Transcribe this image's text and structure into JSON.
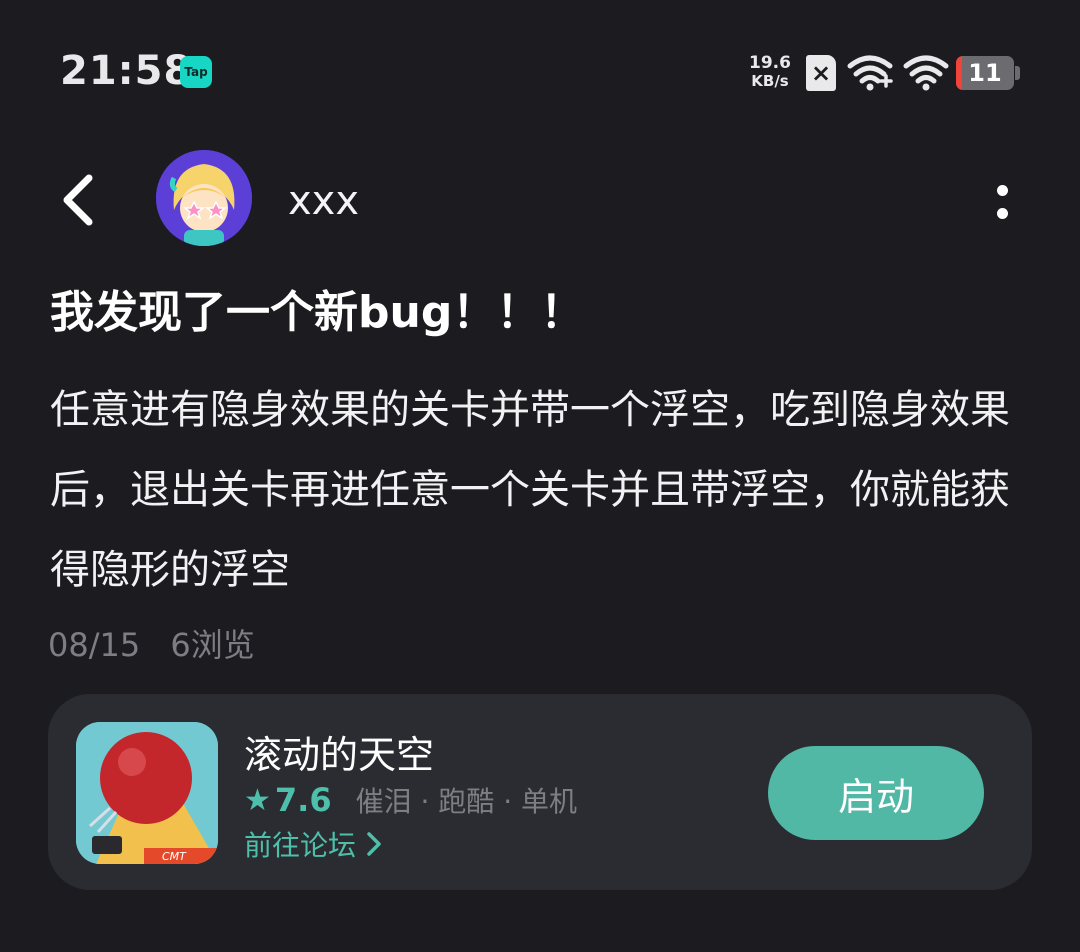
{
  "status_bar": {
    "time": "21:58",
    "tap_badge": "Tap",
    "net_speed_value": "19.6",
    "net_speed_unit": "KB/s",
    "battery_level": "11",
    "icons": [
      "tap-badge-icon",
      "sim-x-icon",
      "wifi-plus-icon",
      "wifi-icon",
      "battery-icon"
    ]
  },
  "header": {
    "back_icon": "chevron-left-icon",
    "username": "xxx",
    "more_icon": "vertical-dots-icon"
  },
  "post": {
    "title": "我发现了一个新bug！！！",
    "body": "任意进有隐身效果的关卡并带一个浮空，吃到隐身效果后，退出关卡再进任意一个关卡并且带浮空，你就能获得隐形的浮空",
    "date": "08/15",
    "views": "6浏览"
  },
  "game_card": {
    "name": "滚动的天空",
    "rating": "7.6",
    "tags": "催泪 · 跑酷 · 单机",
    "forum_link": "前往论坛",
    "launch_label": "启动",
    "accent_color": "#50b8a5"
  }
}
